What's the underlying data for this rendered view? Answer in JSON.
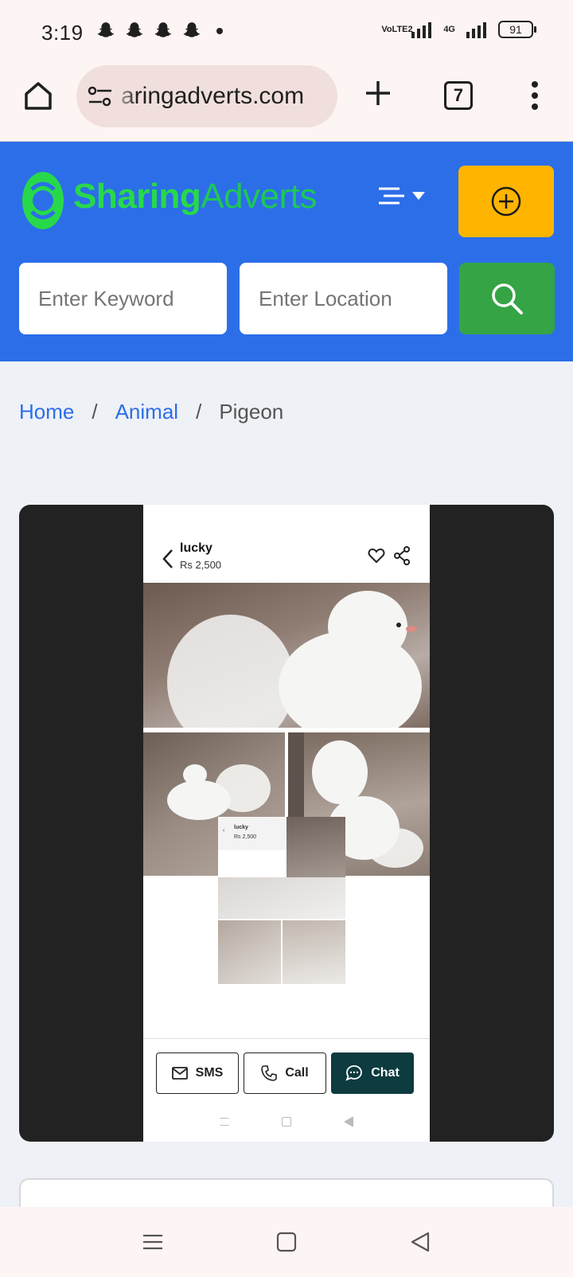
{
  "status_bar": {
    "time": "3:19",
    "notification_icons": [
      "snapchat-icon",
      "snapchat-icon",
      "snapchat-icon",
      "snapchat-icon"
    ],
    "network_label": "VoLTE2",
    "network_gen": "4G",
    "battery_percent": "91"
  },
  "browser": {
    "url": "aringadverts.com",
    "tab_count": "7"
  },
  "site": {
    "brand_part1": "Sharing",
    "brand_part2": "Adverts",
    "keyword_placeholder": "Enter Keyword",
    "location_placeholder": "Enter Location",
    "colors": {
      "header": "#2c6ee8",
      "post_button": "#ffb400",
      "search_button": "#34a445",
      "brand": "#27d94a"
    }
  },
  "breadcrumb": {
    "items": [
      "Home",
      "Animal",
      "Pigeon"
    ],
    "separator": "/"
  },
  "listing": {
    "title": "lucky",
    "price": "Rs 2,500",
    "mini_title": "lucky",
    "mini_price": "Rs 2,500",
    "actions": {
      "sms": "SMS",
      "call": "Call",
      "chat": "Chat"
    }
  }
}
